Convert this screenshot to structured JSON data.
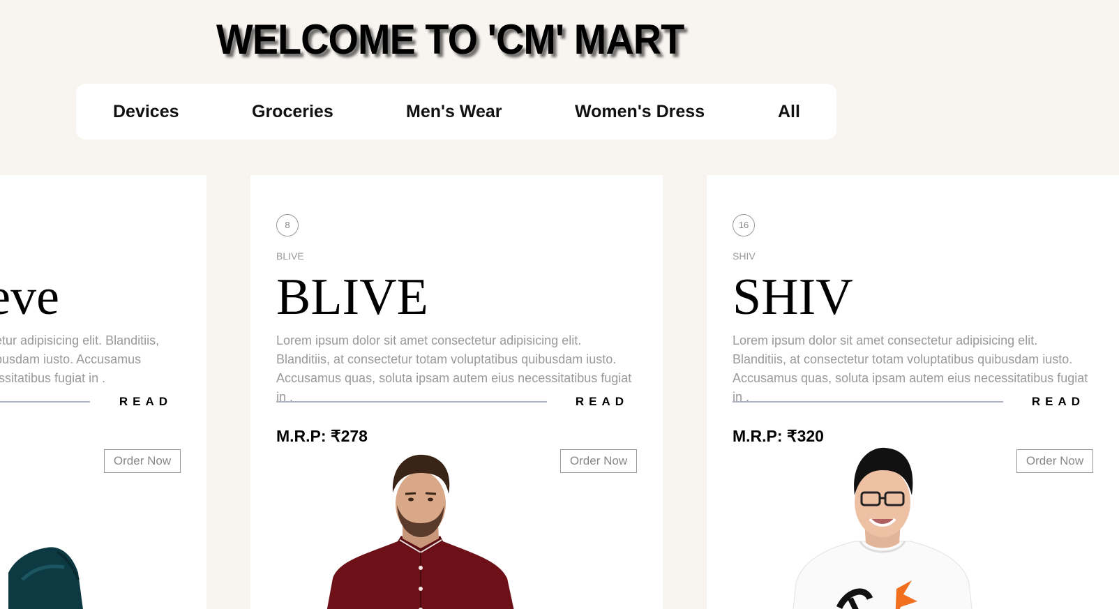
{
  "header": {
    "title": "WELCOME TO 'CM' MART"
  },
  "nav": {
    "items": [
      {
        "label": "Devices"
      },
      {
        "label": "Groceries"
      },
      {
        "label": "Men's Wear"
      },
      {
        "label": "Women's Dress"
      },
      {
        "label": "All"
      }
    ]
  },
  "products": [
    {
      "title_visible": "eve",
      "desc_visible": "ectetur adipisicing elit. Blanditiis, quibusdam iusto. Accusamus ecessitatibus fugiat in .",
      "read_label": "READ",
      "order_label": "Order Now",
      "image_icon": "man-in-dark-teal-shirt-photo"
    },
    {
      "number": "8",
      "label": "BLIVE",
      "title": "BLIVE",
      "description": "Lorem ipsum dolor sit amet consectetur adipisicing elit. Blanditiis, at consectetur totam voluptatibus quibusdam iusto. Accusamus quas, soluta ipsam autem eius necessitatibus fugiat in .",
      "read_label": "READ",
      "price": "M.R.P: ₹278",
      "order_label": "Order Now",
      "image_icon": "man-in-maroon-shirt-photo"
    },
    {
      "number": "16",
      "label": "SHIV",
      "title": "SHIV",
      "description": "Lorem ipsum dolor sit amet consectetur adipisicing elit. Blanditiis, at consectetur totam voluptatibus quibusdam iusto. Accusamus quas, soluta ipsam autem eius necessitatibus fugiat in .",
      "read_label": "READ",
      "price": "M.R.P: ₹320",
      "order_label": "Order Now",
      "image_icon": "boy-in-white-tshirt-photo"
    }
  ],
  "colors": {
    "page_background": "#f8f5f1",
    "card_background": "#ffffff",
    "read_line": "#aab3c2",
    "muted_text": "#999999"
  }
}
